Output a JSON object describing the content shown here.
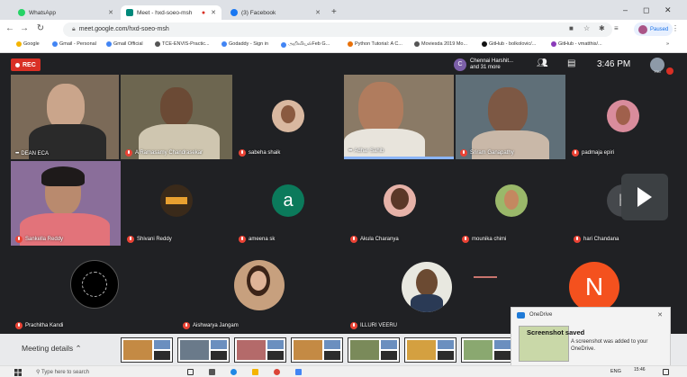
{
  "browser": {
    "tabs": [
      {
        "title": "WhatsApp",
        "active": false,
        "icon": "whatsapp-icon",
        "color": "#25d366"
      },
      {
        "title": "Meet - hxd-soeo-msh",
        "active": true,
        "icon": "meet-icon",
        "color": "#00897b"
      },
      {
        "title": "(3) Facebook",
        "active": false,
        "icon": "facebook-icon",
        "color": "#1877f2"
      }
    ],
    "new_tab": "+",
    "url": "meet.google.com/hxd-soeo-msh",
    "profile": "Paused",
    "bookmarks": [
      "Google",
      "Gmail - Personal",
      "Gmail Official",
      "TCE-ENVIS-Practic...",
      "Godaddy - Sign in",
      "அறிவியல்Feb G...",
      "Python Tutorial: A C...",
      "Moviesda 2019 Mo...",
      "GitHub - bolkolovic/...",
      "GitHub - vmatthis/..."
    ]
  },
  "meet": {
    "rec_label": "REC",
    "participants_chip": {
      "avatar_letter": "C",
      "line1": "Chennai Harshit...",
      "line2": "and 31 more"
    },
    "time": "3:46 PM",
    "you_label": "You",
    "tiles": [
      {
        "name": "DEAN ECA",
        "kind": "video",
        "dots": true,
        "muted": false
      },
      {
        "name": "A Ramasamy Chandrasekar",
        "kind": "video",
        "dots": false,
        "muted": true
      },
      {
        "name": "sabeha shaik",
        "kind": "avatar",
        "dots": false,
        "muted": true
      },
      {
        "name": "Adhar Sahib",
        "kind": "video",
        "dots": true,
        "muted": false
      },
      {
        "name": "Sriram Ganapathy",
        "kind": "video",
        "dots": false,
        "muted": true
      },
      {
        "name": "padmaja epiri",
        "kind": "avatar",
        "dots": false,
        "muted": true
      },
      {
        "name": "Sankella Reddy",
        "kind": "video",
        "dots": false,
        "muted": true
      },
      {
        "name": "Shivani Reddy",
        "kind": "avatar",
        "dots": false,
        "muted": true
      },
      {
        "name": "ameena sk",
        "kind": "letter",
        "letter": "a",
        "letter_color": "#0b7a5b",
        "dots": false,
        "muted": true
      },
      {
        "name": "Akula Charanya",
        "kind": "avatar",
        "dots": false,
        "muted": true
      },
      {
        "name": "mounika chimi",
        "kind": "avatar",
        "dots": false,
        "muted": true
      },
      {
        "name": "hari Chandana",
        "kind": "letter",
        "letter": "h",
        "letter_color": "#5f6368",
        "dots": false,
        "muted": true
      },
      {
        "name": "Prachitha Kandi",
        "kind": "avatar",
        "dots": false,
        "muted": true
      },
      {
        "name": "Aishwarya Jangam",
        "kind": "avatar",
        "dots": false,
        "muted": true
      },
      {
        "name": "ILLURI VEERU",
        "kind": "avatar",
        "dots": false,
        "muted": true
      },
      {
        "name": "",
        "kind": "blank",
        "dots": false,
        "muted": false
      },
      {
        "name": "",
        "kind": "letter",
        "letter": "N",
        "letter_color": "#f4511e",
        "dots": false,
        "muted": false
      }
    ],
    "meeting_details": "Meeting details",
    "next_icon": "chevron-right-icon"
  },
  "toast": {
    "app": "OneDrive",
    "title": "Screenshot saved",
    "body": "A screenshot was added to your OneDrive."
  },
  "taskbar": {
    "search_placeholder": "Type here to search",
    "lang": "ENG",
    "time": "15:46"
  }
}
